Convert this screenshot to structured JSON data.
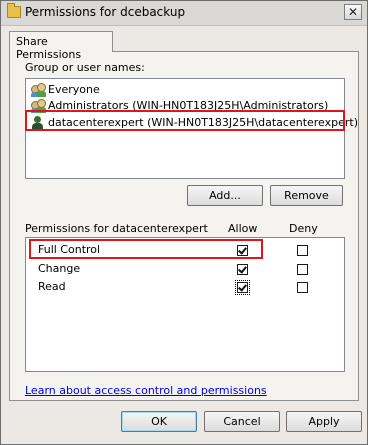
{
  "window": {
    "title": "Permissions for dcebackup"
  },
  "tabs": [
    {
      "label": "Share Permissions"
    }
  ],
  "group_section": {
    "label": "Group or user names:",
    "items": [
      {
        "label": "Everyone",
        "icon": "group-icon",
        "selected": false
      },
      {
        "label": "Administrators (WIN-HN0T183J25H\\Administrators)",
        "icon": "group-icon",
        "selected": false
      },
      {
        "label": "datacenterexpert (WIN-HN0T183J25H\\datacenterexpert)",
        "icon": "user-icon",
        "selected": true
      }
    ]
  },
  "buttons": {
    "add": "Add...",
    "remove": "Remove",
    "ok": "OK",
    "cancel": "Cancel",
    "apply": "Apply"
  },
  "permissions": {
    "label": "Permissions for datacenterexpert",
    "allow_header": "Allow",
    "deny_header": "Deny",
    "rows": [
      {
        "name": "Full Control",
        "allow": true,
        "deny": false
      },
      {
        "name": "Change",
        "allow": true,
        "deny": false
      },
      {
        "name": "Read",
        "allow": true,
        "deny": false
      }
    ]
  },
  "link": {
    "text": "Learn about access control and permissions"
  },
  "colors": {
    "highlight": "#e0141a",
    "link": "#0000ee"
  }
}
